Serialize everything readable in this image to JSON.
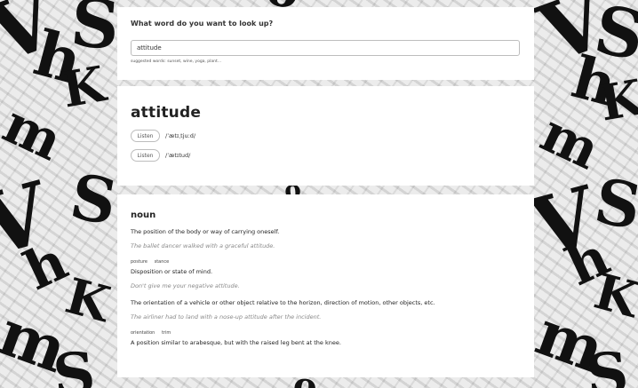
{
  "search": {
    "label": "What word do you want to look up?",
    "value": "attitude",
    "suggested_prefix": "suggested words:",
    "suggested_words": "sunset, wine, yoga, plant..."
  },
  "entry": {
    "word": "attitude",
    "pronunciations": [
      {
        "listen_label": "Listen",
        "ipa": "/ˈætɪˌtjuːd/"
      },
      {
        "listen_label": "Listen",
        "ipa": "/ˈætɪtud/"
      }
    ]
  },
  "definitions": {
    "part_of_speech": "noun",
    "senses": [
      {
        "definition": "The position of the body or way of carrying oneself.",
        "example": "The ballet dancer walked with a graceful attitude.",
        "synonyms": [
          "posture",
          "stance"
        ]
      },
      {
        "definition": "Disposition or state of mind.",
        "example": "Don't give me your negative attitude.",
        "synonyms": []
      },
      {
        "definition": "The orientation of a vehicle or other object relative to the horizon, direction of motion, other objects, etc.",
        "example": "The airliner had to land with a nose-up attitude after the incident.",
        "synonyms": [
          "orientation",
          "trim"
        ]
      },
      {
        "definition": "A position similar to arabesque, but with the raised leg bent at the knee.",
        "example": "",
        "synonyms": []
      }
    ]
  },
  "colors": {
    "card_bg": "#ffffff",
    "text": "#222222",
    "muted": "#888888",
    "border": "#bdbdbd"
  }
}
